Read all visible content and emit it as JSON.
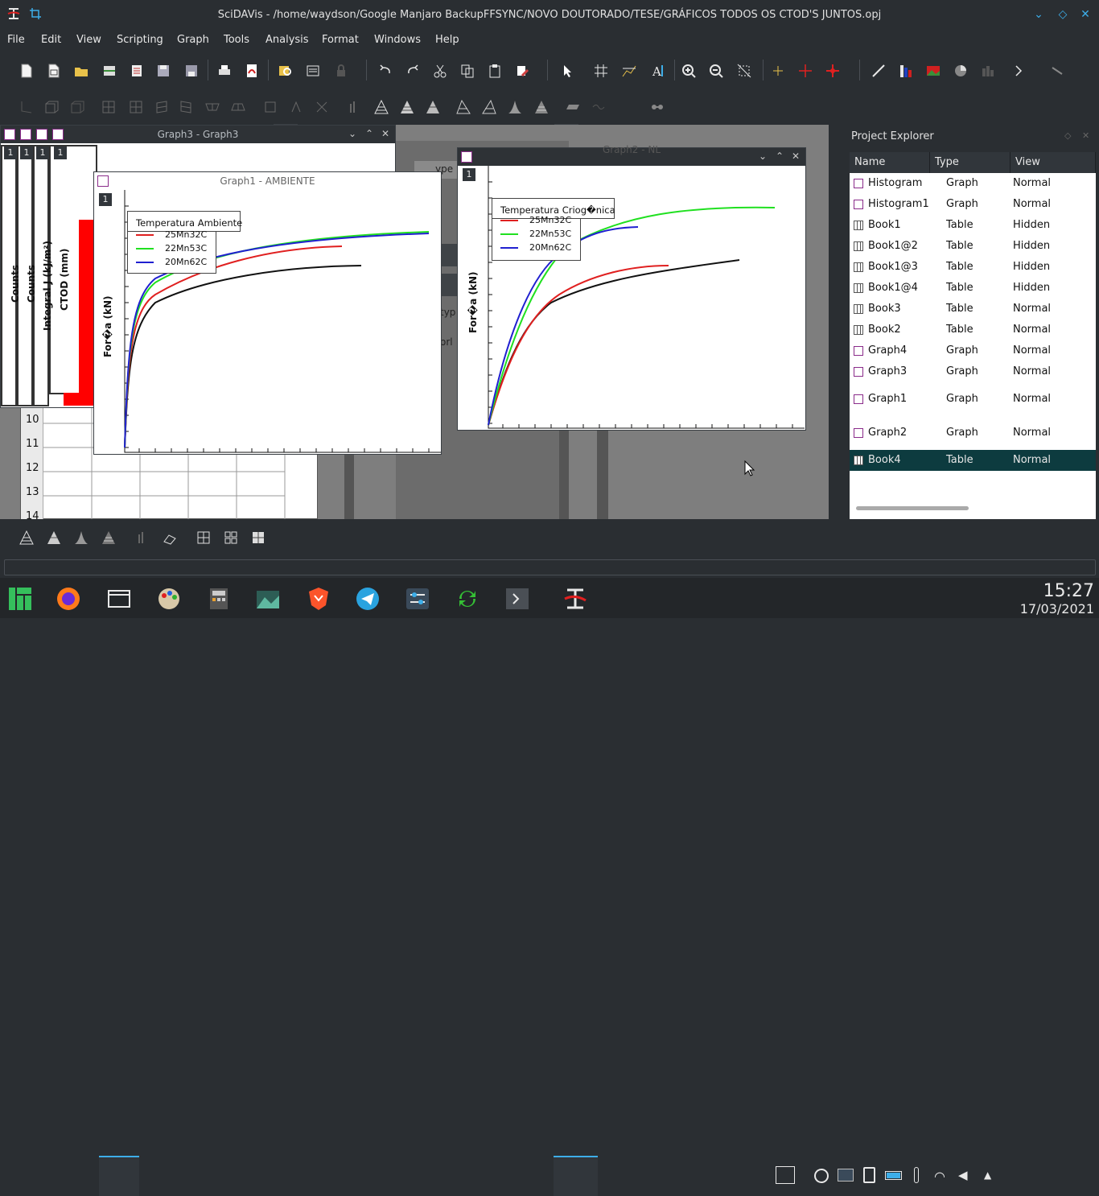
{
  "window": {
    "title": "SciDAVis - /home/waydson/Google Manjaro BackupFFSYNC/NOVO DOUTORADO/TESE/GRÁFICOS TODOS OS CTOD'S JUNTOS.opj"
  },
  "menu": [
    "File",
    "Edit",
    "View",
    "Scripting",
    "Graph",
    "Tools",
    "Analysis",
    "Format",
    "Windows",
    "Help"
  ],
  "graph3": {
    "title": "Graph3 - Graph3",
    "layer": "1",
    "side_labels": [
      "Counts",
      "Counts",
      "Integral J (kJ/m²)",
      "CTOD (mm)"
    ]
  },
  "graph1": {
    "title": "Graph1 - AMBIENTE",
    "layer": "1",
    "legend_title": "Temperatura Ambiente",
    "ylabel": "For�a (kN)",
    "series": [
      {
        "name": "25Mn32C",
        "color": "#e02020"
      },
      {
        "name": "22Mn53C",
        "color": "#20e020"
      },
      {
        "name": "20Mn62C",
        "color": "#2020d0"
      }
    ]
  },
  "graph2": {
    "title": "Graph2 - NL",
    "layer": "1",
    "legend_title": "Temperatura Criog�nica",
    "ylabel": "For�a (kN)",
    "series": [
      {
        "name": "25Mn32C",
        "color": "#e02020"
      },
      {
        "name": "22Mn53C",
        "color": "#20e020"
      },
      {
        "name": "20Mn62C",
        "color": "#2020d0"
      }
    ]
  },
  "table_rows": [
    "10",
    "11",
    "12",
    "13",
    "14"
  ],
  "hidden_text": {
    "typ": "typ",
    "orl": "orl"
  },
  "explorer": {
    "title": "Project Explorer",
    "headers": [
      "Name",
      "Type",
      "View"
    ],
    "rows": [
      {
        "name": "Histogram",
        "type": "Graph",
        "view": "Normal",
        "icon": "graph-icon"
      },
      {
        "name": "Histogram1",
        "type": "Graph",
        "view": "Normal",
        "icon": "graph-icon"
      },
      {
        "name": "Book1",
        "type": "Table",
        "view": "Hidden",
        "icon": "table-icon"
      },
      {
        "name": "Book1@2",
        "type": "Table",
        "view": "Hidden",
        "icon": "table-icon"
      },
      {
        "name": "Book1@3",
        "type": "Table",
        "view": "Hidden",
        "icon": "table-icon"
      },
      {
        "name": "Book1@4",
        "type": "Table",
        "view": "Hidden",
        "icon": "table-icon"
      },
      {
        "name": "Book3",
        "type": "Table",
        "view": "Normal",
        "icon": "table-icon"
      },
      {
        "name": "Book2",
        "type": "Table",
        "view": "Normal",
        "icon": "table-icon"
      },
      {
        "name": "Graph4",
        "type": "Graph",
        "view": "Normal",
        "icon": "graph-icon"
      },
      {
        "name": "Graph3",
        "type": "Graph",
        "view": "Normal",
        "icon": "graph-icon"
      },
      {
        "name": "Graph1",
        "type": "Graph",
        "view": "Normal",
        "icon": "graph-icon"
      },
      {
        "name": "Graph2",
        "type": "Graph",
        "view": "Normal",
        "icon": "graph-icon"
      },
      {
        "name": "Book4",
        "type": "Table",
        "view": "Normal",
        "icon": "table-icon",
        "selected": true
      }
    ]
  },
  "clock": {
    "time": "15:27",
    "date": "17/03/2021"
  },
  "colors": {
    "accent": "#3daee9",
    "selection": "#0d3b3f",
    "panel": "#2a2e32"
  }
}
